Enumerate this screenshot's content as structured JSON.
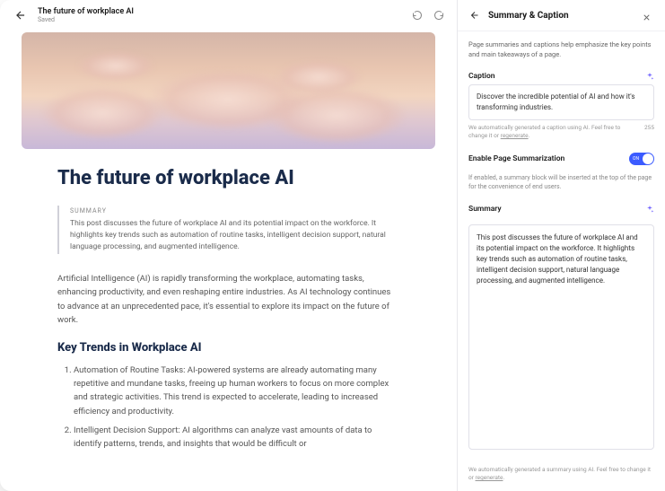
{
  "header": {
    "title": "The future of workplace AI",
    "status": "Saved"
  },
  "article": {
    "heading": "The future of workplace AI",
    "summary_label": "SUMMARY",
    "summary_text": "This post discusses the future of workplace AI and its potential impact on the workforce. It highlights key trends such as automation of routine tasks, intelligent decision support, natural language processing, and augmented intelligence.",
    "intro": "Artificial Intelligence (AI) is rapidly transforming the workplace, automating tasks, enhancing productivity, and even reshaping entire industries. As AI technology continues to advance at an unprecedented pace, it's essential to explore its impact on the future of work.",
    "trends_heading": "Key Trends in Workplace AI",
    "trends": [
      "Automation of Routine Tasks: AI-powered systems are already automating many repetitive and mundane tasks, freeing up human workers to focus on more complex and strategic activities. This trend is expected to accelerate, leading to increased efficiency and productivity.",
      "Intelligent Decision Support: AI algorithms can analyze vast amounts of data to identify patterns, trends, and insights that would be difficult or"
    ]
  },
  "panel": {
    "title": "Summary & Caption",
    "description": "Page summaries and captions help emphasize the key points and main takeaways of a page.",
    "caption_label": "Caption",
    "caption_value": "Discover the incredible potential of AI and how it's transforming industries.",
    "caption_hint": "We automatically generated a caption using AI. Feel free to change it or ",
    "regenerate_link": "regenerate",
    "caption_count": "255",
    "toggle_label": "Enable Page Summarization",
    "toggle_state": "ON",
    "toggle_desc": "If enabled, a summary block will be inserted at the top of the page for the convenience of end users.",
    "summary_label": "Summary",
    "summary_value": "This post discusses the future of workplace AI and its potential impact on the workforce. It highlights key trends such as automation of routine tasks, intelligent decision support, natural language processing, and augmented intelligence.",
    "summary_hint": "We automatically generated a summary using AI. Feel free to change it or "
  }
}
